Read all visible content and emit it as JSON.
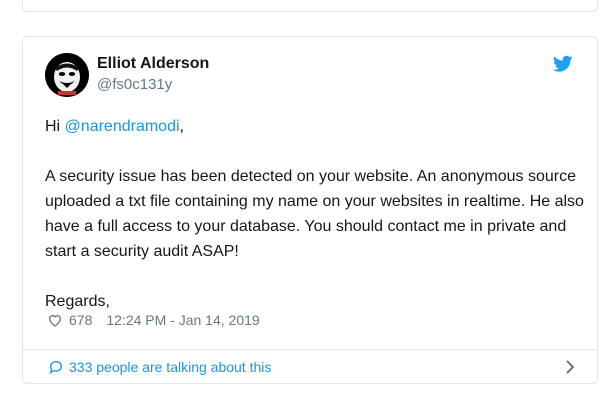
{
  "tweet": {
    "author_name": "Elliot Alderson",
    "author_handle": "@fs0c131y",
    "greeting": "Hi ",
    "mention": "@narendramodi",
    "greeting_end": ",",
    "body": "A security issue has been detected on your website. An anonymous source uploaded a txt file containing my name on your websites in realtime. He also have a full access to your database. You should contact me in private and start a security audit ASAP!",
    "signoff": "Regards,",
    "likes": "678",
    "timestamp": "12:24 PM - Jan 14, 2019",
    "talking": "333 people are talking about this"
  },
  "icons": {
    "bird": "twitter-bird-icon",
    "heart": "heart-icon",
    "bubble": "speech-bubble-icon",
    "chevron": "chevron-right-icon"
  },
  "colors": {
    "link": "#1b95e0",
    "muted": "#657786",
    "text": "#14171a",
    "border": "#e1e8ed"
  }
}
